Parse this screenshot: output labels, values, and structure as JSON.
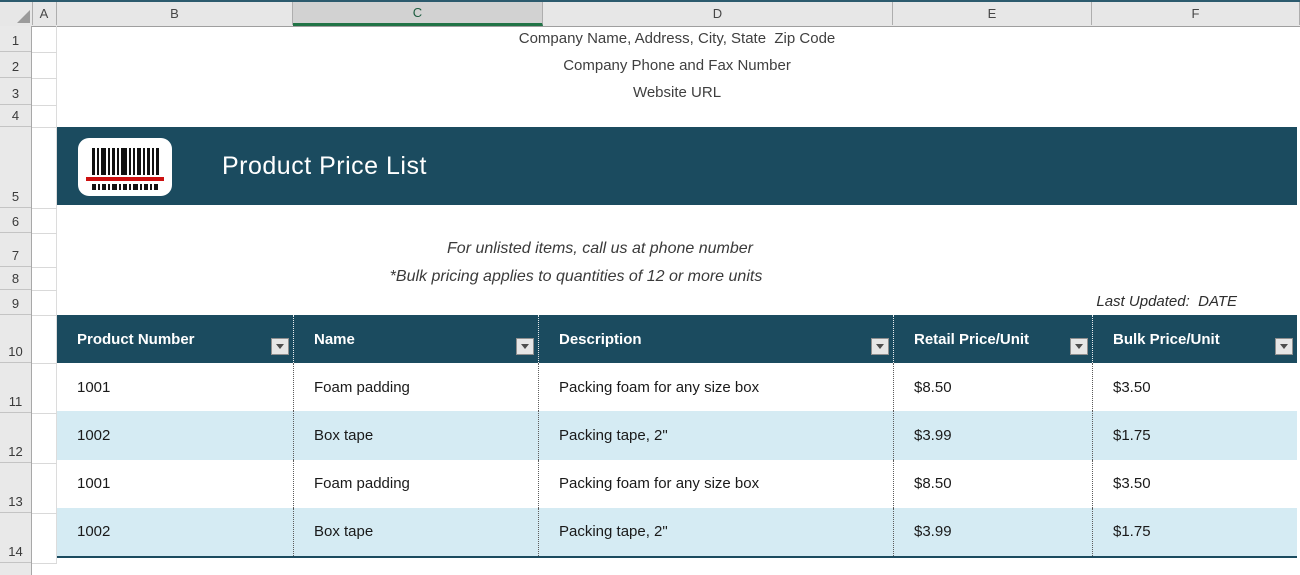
{
  "spreadsheet": {
    "column_headers": [
      "A",
      "B",
      "C",
      "D",
      "E",
      "F"
    ],
    "selected_column": "C",
    "row_headers": [
      "1",
      "2",
      "3",
      "4",
      "5",
      "6",
      "7",
      "8",
      "9",
      "10",
      "11",
      "12",
      "13",
      "14"
    ]
  },
  "company": {
    "line1": "Company Name, Address, City, State  Zip Code",
    "line2": "Company Phone and Fax Number",
    "line3": "Website URL"
  },
  "banner": {
    "title": "Product Price List",
    "icon": "barcode-icon",
    "background_color": "#1B4B5F",
    "scanner_line_color": "#CC1111"
  },
  "notes": {
    "line1": "For unlisted items, call us at phone number",
    "line2": "*Bulk pricing applies to quantities of 12 or more units",
    "last_updated": "Last Updated:  DATE"
  },
  "table": {
    "header_bg": "#1B4B5F",
    "band_color": "#D5EBF3",
    "selection_green": "#217346",
    "columns": [
      "Product Number",
      "Name",
      "Description",
      "Retail Price/Unit",
      "Bulk Price/Unit"
    ],
    "rows": [
      [
        "1001",
        "Foam padding",
        "Packing foam for any size box",
        "$8.50",
        "$3.50"
      ],
      [
        "1002",
        "Box tape",
        "Packing tape, 2\"",
        "$3.99",
        "$1.75"
      ],
      [
        "1001",
        "Foam padding",
        "Packing foam for any size box",
        "$8.50",
        "$3.50"
      ],
      [
        "1002",
        "Box tape",
        "Packing tape, 2\"",
        "$3.99",
        "$1.75"
      ]
    ]
  }
}
